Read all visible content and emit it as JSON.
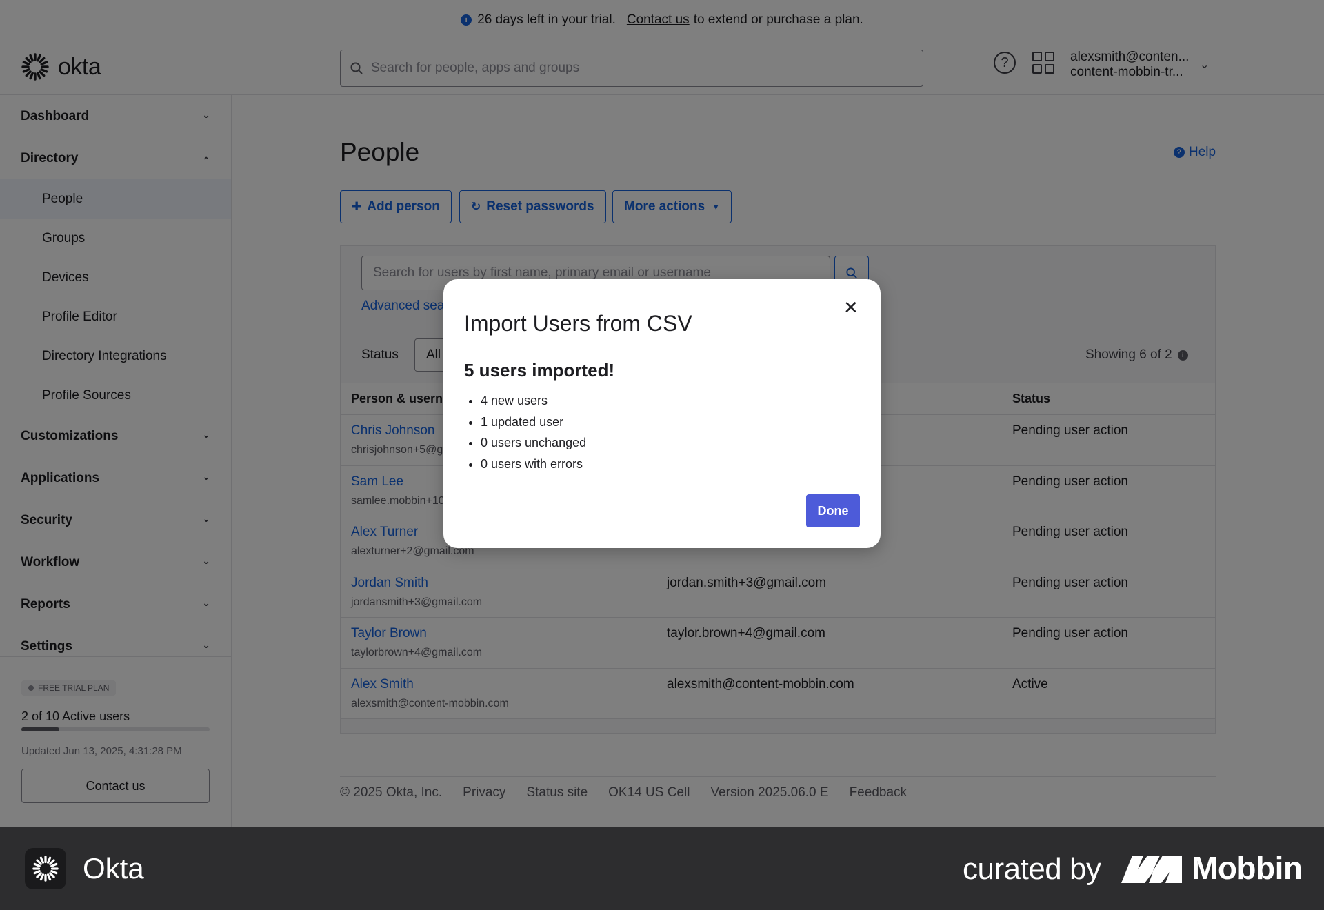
{
  "banner": {
    "text": "26 days left in your trial.",
    "link": "Contact us",
    "suffix": "to extend or purchase a plan."
  },
  "header": {
    "logo": "okta",
    "search_placeholder": "Search for people, apps and groups",
    "account_email": "alexsmith@conten...",
    "account_org": "content-mobbin-tr..."
  },
  "sidebar": {
    "groups": [
      {
        "label": "Dashboard"
      },
      {
        "label": "Directory"
      },
      {
        "label": "Customizations"
      },
      {
        "label": "Applications"
      },
      {
        "label": "Security"
      },
      {
        "label": "Workflow"
      },
      {
        "label": "Reports"
      },
      {
        "label": "Settings"
      }
    ],
    "directory_items": [
      {
        "label": "People"
      },
      {
        "label": "Groups"
      },
      {
        "label": "Devices"
      },
      {
        "label": "Profile Editor"
      },
      {
        "label": "Directory Integrations"
      },
      {
        "label": "Profile Sources"
      }
    ],
    "plan_badge": "FREE TRIAL PLAN",
    "active_users": "2 of 10 Active users",
    "active_users_fraction": 0.2,
    "updated": "Updated Jun 13, 2025, 4:31:28 PM",
    "contact": "Contact us"
  },
  "page": {
    "title": "People",
    "help": "Help",
    "add_person": "Add person",
    "reset_passwords": "Reset passwords",
    "more_actions": "More actions",
    "user_search_placeholder": "Search for users by first name, primary email or username",
    "advanced_search": "Advanced search",
    "status_label": "Status",
    "status_value": "All",
    "showing": "Showing 6 of 2"
  },
  "table": {
    "headers": {
      "person": "Person & username",
      "status": "Status"
    },
    "rows": [
      {
        "name": "Chris Johnson",
        "username": "chrisjohnson+5@gmail.com",
        "email": "",
        "status": "Pending user action"
      },
      {
        "name": "Sam Lee",
        "username": "samlee.mobbin+10@gmail.com",
        "email": "",
        "status": "Pending user action"
      },
      {
        "name": "Alex Turner",
        "username": "alexturner+2@gmail.com",
        "email": "",
        "status": "Pending user action"
      },
      {
        "name": "Jordan Smith",
        "username": "jordansmith+3@gmail.com",
        "email": "jordan.smith+3@gmail.com",
        "status": "Pending user action"
      },
      {
        "name": "Taylor Brown",
        "username": "taylorbrown+4@gmail.com",
        "email": "taylor.brown+4@gmail.com",
        "status": "Pending user action"
      },
      {
        "name": "Alex Smith",
        "username": "alexsmith@content-mobbin.com",
        "email": "alexsmith@content-mobbin.com",
        "status": "Active"
      }
    ]
  },
  "footer": {
    "copyright": "© 2025 Okta, Inc.",
    "privacy": "Privacy",
    "status_site": "Status site",
    "cell": "OK14 US Cell",
    "version": "Version 2025.06.0 E",
    "feedback": "Feedback"
  },
  "modal": {
    "title": "Import Users from CSV",
    "subtitle": "5 users imported!",
    "items": [
      "4 new users",
      "1 updated user",
      "0 users unchanged",
      "0 users with errors"
    ],
    "done": "Done"
  },
  "branding": {
    "app_name": "Okta",
    "curated_by": "curated by",
    "mobbin": "Mobbin"
  },
  "colors": {
    "accent": "#1662dd",
    "primary_button": "#4d5bd9",
    "brand_bar": "#2d2d2f"
  }
}
